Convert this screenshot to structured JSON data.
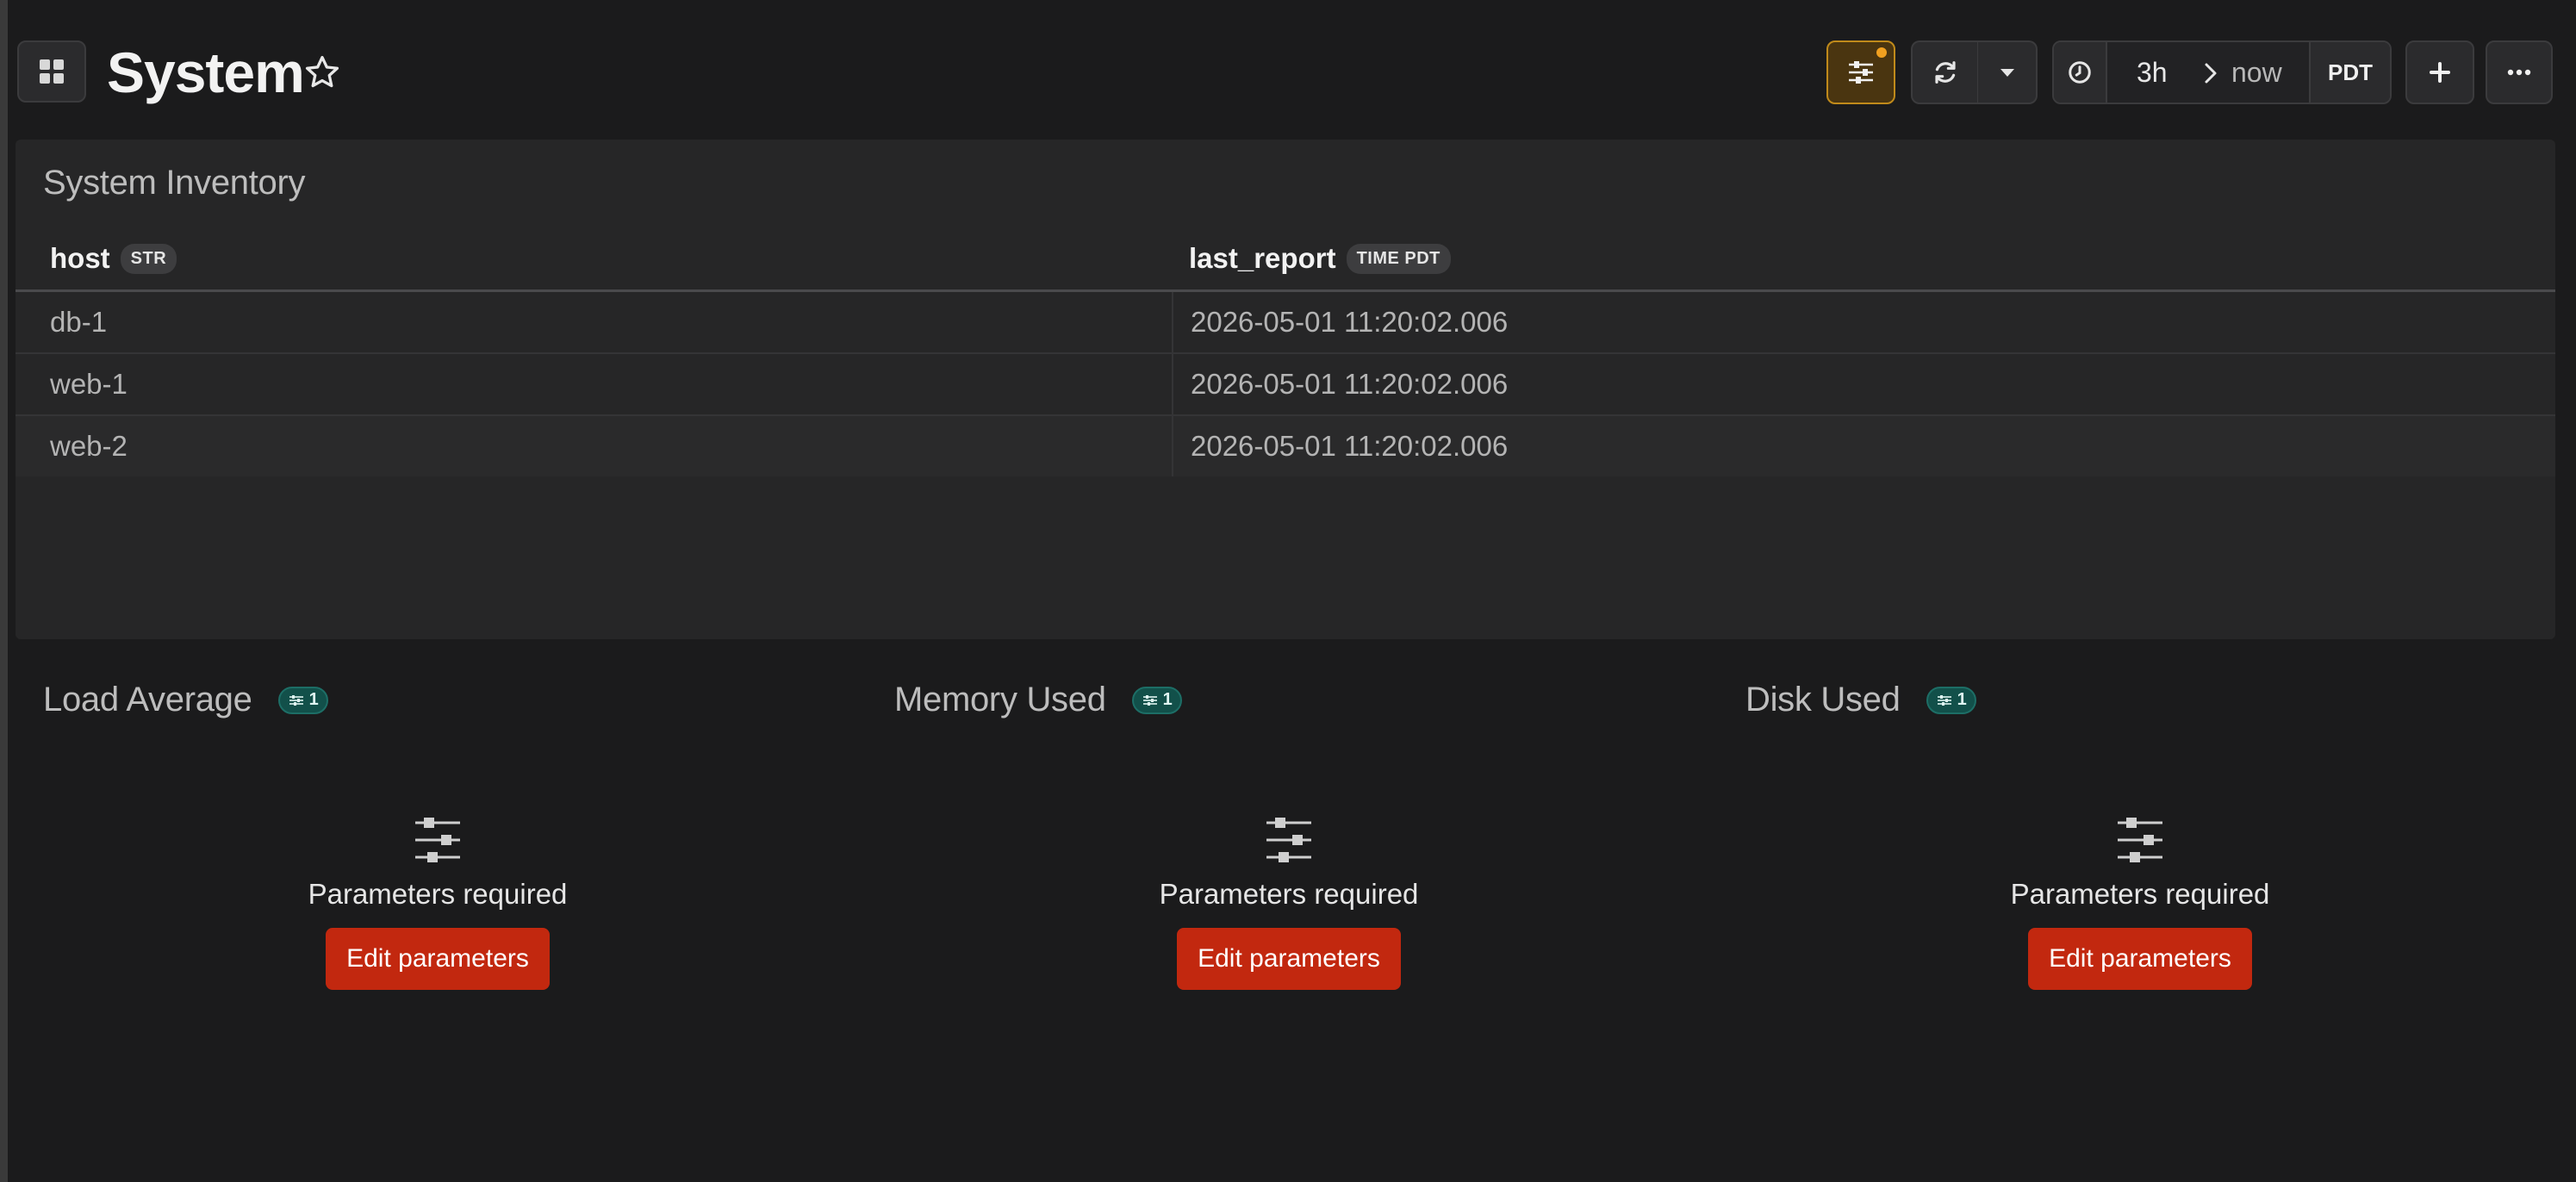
{
  "header": {
    "title": "System",
    "time_range": {
      "start": "3h",
      "end": "now",
      "timezone": "PDT"
    },
    "accent_color": "#c08a1a"
  },
  "inventory": {
    "title": "System Inventory",
    "columns": [
      {
        "label": "host",
        "type": "STR"
      },
      {
        "label": "last_report",
        "type": "TIME PDT"
      }
    ],
    "rows": [
      {
        "host": "db-1",
        "last_report": "2026-05-01 11:20:02.006"
      },
      {
        "host": "web-1",
        "last_report": "2026-05-01 11:20:02.006"
      },
      {
        "host": "web-2",
        "last_report": "2026-05-01 11:20:02.006"
      }
    ]
  },
  "metrics": [
    {
      "title": "Load Average",
      "param_count": "1",
      "message": "Parameters required",
      "button": "Edit parameters"
    },
    {
      "title": "Memory Used",
      "param_count": "1",
      "message": "Parameters required",
      "button": "Edit parameters"
    },
    {
      "title": "Disk Used",
      "param_count": "1",
      "message": "Parameters required",
      "button": "Edit parameters"
    }
  ],
  "colors": {
    "edit_button": "#c2280f",
    "param_badge": "#12504a"
  }
}
